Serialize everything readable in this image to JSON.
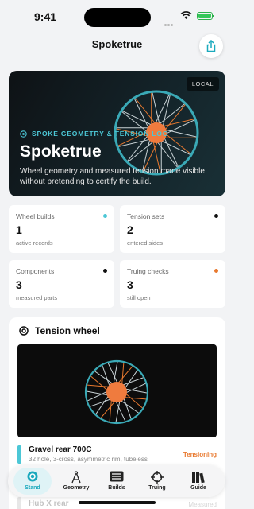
{
  "status_bar": {
    "time": "9:41"
  },
  "nav": {
    "title": "Spoketrue",
    "share_icon": "share-icon"
  },
  "hero": {
    "badge": "LOCAL",
    "eyebrow": "SPOKE GEOMETRY & TENSION LOG",
    "title": "Spoketrue",
    "subtitle": "Wheel geometry and measured tension made visible without pretending to certify the build."
  },
  "stats": [
    {
      "label": "Wheel builds",
      "value": "1",
      "note": "active records",
      "dot_color": "#4cc7d6"
    },
    {
      "label": "Tension sets",
      "value": "2",
      "note": "entered sides",
      "dot_color": "#111111"
    },
    {
      "label": "Components",
      "value": "3",
      "note": "measured parts",
      "dot_color": "#111111"
    },
    {
      "label": "Truing checks",
      "value": "3",
      "note": "still open",
      "dot_color": "#e8792f"
    }
  ],
  "tension_panel": {
    "title": "Tension wheel",
    "builds": [
      {
        "name": "Gravel rear 700C",
        "description": "32 hole, 3-cross, asymmetric rim, tubeless",
        "status": "Tensioning"
      }
    ],
    "partial_rows": [
      {
        "name": "Hub X rear",
        "status": "Measured"
      }
    ]
  },
  "tabs": [
    {
      "label": "Stand",
      "icon": "stand-icon",
      "active": true
    },
    {
      "label": "Geometry",
      "icon": "compass-icon",
      "active": false
    },
    {
      "label": "Builds",
      "icon": "list-icon",
      "active": false
    },
    {
      "label": "Truing",
      "icon": "crosshair-icon",
      "active": false
    },
    {
      "label": "Guide",
      "icon": "books-icon",
      "active": false
    }
  ],
  "colors": {
    "accent": "#4cc7d6",
    "orange": "#e8792f",
    "hub": "#ef7b3e"
  }
}
